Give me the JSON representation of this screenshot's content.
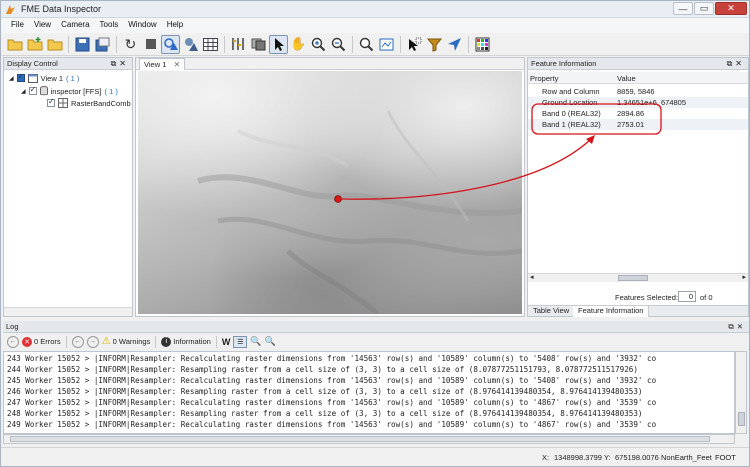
{
  "window": {
    "title": "FME Data Inspector"
  },
  "menu": [
    "File",
    "View",
    "Camera",
    "Tools",
    "Window",
    "Help"
  ],
  "display_control": {
    "title": "Display Control",
    "tree": [
      {
        "label": "View 1",
        "count": "( 1 )"
      },
      {
        "label": "inspector [FFS]",
        "count": "( 1 )"
      },
      {
        "label": "RasterBandComb"
      }
    ]
  },
  "view": {
    "tab_label": "View 1"
  },
  "feature_info": {
    "title": "Feature Information",
    "columns": [
      "Property",
      "Value"
    ],
    "rows": [
      {
        "property": "Row and Column",
        "value": "8859, 5846"
      },
      {
        "property": "Ground Location",
        "value": "1.34651e+6, 674805"
      },
      {
        "property": "Band 0 (REAL32)",
        "value": "2894.86"
      },
      {
        "property": "Band 1 (REAL32)",
        "value": "2753.01"
      }
    ],
    "features_selected_label": "Features Selected:",
    "features_selected_value": "0",
    "features_total": "of 0",
    "tabs": [
      "Table View",
      "Feature Information"
    ]
  },
  "log": {
    "title": "Log",
    "errors": "0 Errors",
    "warnings": "0 Warnings",
    "information": "Information",
    "lines": [
      "243 Worker 15052 > |INFORM|Resampler: Recalculating raster dimensions from '14563' row(s) and '10589' column(s) to '5408' row(s) and '3932' co",
      "244 Worker 15052 > |INFORM|Resampler: Resampling raster from a cell size of (3, 3) to a cell size of (8.07877251151793, 8.078772511517926)",
      "245 Worker 15052 > |INFORM|Resampler: Recalculating raster dimensions from '14563' row(s) and '10589' column(s) to '5408' row(s) and '3932' co",
      "246 Worker 15052 > |INFORM|Resampler: Resampling raster from a cell size of (3, 3) to a cell size of (8.976414139480354, 8.976414139480353)",
      "247 Worker 15052 > |INFORM|Resampler: Recalculating raster dimensions from '14563' row(s) and '10589' column(s) to '4867' row(s) and '3539' co",
      "248 Worker 15052 > |INFORM|Resampler: Resampling raster from a cell size of (3, 3) to a cell size of (8.976414139480354, 8.976414139480353)",
      "249 Worker 15052 > |INFORM|Resampler: Recalculating raster dimensions from '14563' row(s) and '10589' column(s) to '4867' row(s) and '3539' co"
    ]
  },
  "status": {
    "x_label": "X:",
    "x_value": "1348998.3799",
    "y_label": "Y:",
    "y_value": "675198.0076",
    "units": "NonEarth_Feet",
    "suffix": "FOOT"
  },
  "colors": {
    "annotation": "#d3141c",
    "highlight_blue": "#2a6bc2"
  }
}
